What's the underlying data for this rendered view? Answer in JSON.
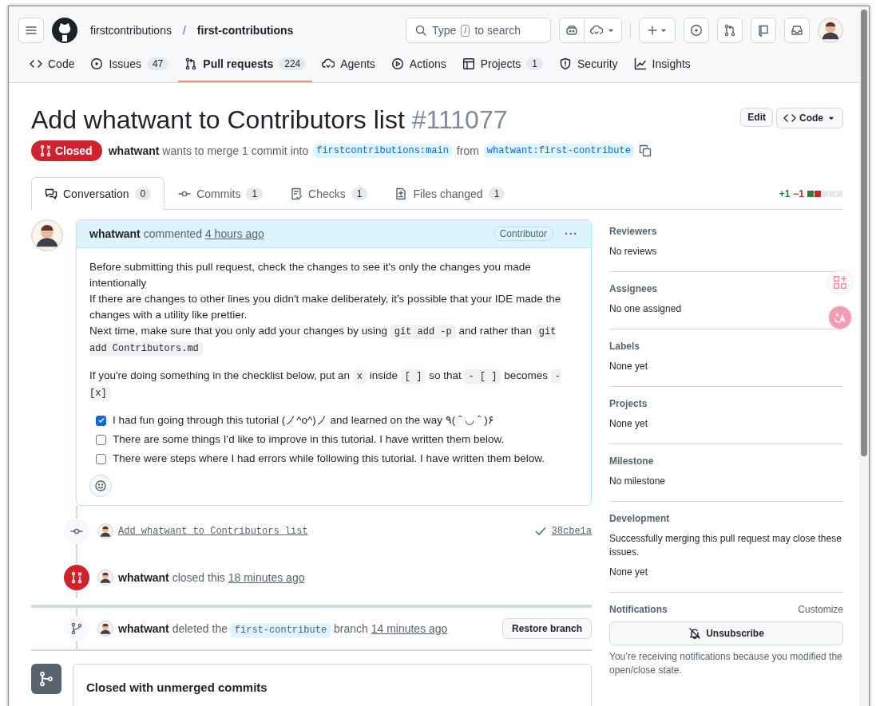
{
  "header": {
    "owner": "firstcontributions",
    "separator": "/",
    "repo": "first-contributions",
    "search": {
      "before": "Type",
      "key": "/",
      "after": "to search"
    }
  },
  "nav": [
    {
      "kind": "code",
      "label": "Code",
      "selected": false
    },
    {
      "kind": "issue",
      "label": "Issues",
      "count": "47",
      "selected": false
    },
    {
      "kind": "pr",
      "label": "Pull requests",
      "count": "224",
      "selected": true
    },
    {
      "kind": "agent",
      "label": "Agents",
      "selected": false
    },
    {
      "kind": "play",
      "label": "Actions",
      "selected": false
    },
    {
      "kind": "table",
      "label": "Projects",
      "count": "1",
      "selected": false
    },
    {
      "kind": "shield",
      "label": "Security",
      "selected": false
    },
    {
      "kind": "graph",
      "label": "Insights",
      "selected": false
    }
  ],
  "pr": {
    "title": "Add whatwant to Contributors list",
    "number": "#111077",
    "state": "Closed",
    "author": "whatwant",
    "summary": "wants to merge 1 commit into",
    "base": "firstcontributions:main",
    "from": "from",
    "head": "whatwant:first-contribute",
    "edit": "Edit",
    "code": "Code"
  },
  "tabs": [
    {
      "kind": "conversation",
      "label": "Conversation",
      "count": "0",
      "selected": true
    },
    {
      "kind": "commit",
      "label": "Commits",
      "count": "1",
      "selected": false
    },
    {
      "kind": "checks",
      "label": "Checks",
      "count": "1",
      "selected": false
    },
    {
      "kind": "files",
      "label": "Files changed",
      "count": "1",
      "selected": false
    }
  ],
  "diffstat": {
    "added": "+1",
    "removed": "−1",
    "blocks": [
      {
        "color": "#1f883d"
      },
      {
        "color": "#cf222e"
      },
      {
        "color": "#e6eaef"
      },
      {
        "color": "#e6eaef"
      },
      {
        "color": "#e6eaef"
      }
    ]
  },
  "comment": {
    "author": "whatwant",
    "action": "commented",
    "time": "4 hours ago",
    "role": "Contributor",
    "menu": "···",
    "paragraphs": [
      {
        "lines": [
          [
            {
              "text": "Before submitting this pull request, check the changes to see it's only the changes you made intentionally",
              "code": false
            }
          ],
          [
            {
              "text": "If there are changes to other lines you didn't make deliberately, it's possible that your IDE made the changes with a utility like prettier.",
              "code": false
            }
          ],
          [
            {
              "text": "Next time, make sure that you only add your changes by using ",
              "code": false
            },
            {
              "text": "git add -p",
              "code": true
            },
            {
              "text": " and rather than ",
              "code": false
            },
            {
              "text": "git add Contributors.md",
              "code": true
            }
          ]
        ]
      },
      {
        "lines": [
          [
            {
              "text": "If you're doing something in the checklist below, put an ",
              "code": false
            },
            {
              "text": "x",
              "code": true
            },
            {
              "text": " inside ",
              "code": false
            },
            {
              "text": "[ ]",
              "code": true
            },
            {
              "text": " so that ",
              "code": false
            },
            {
              "text": "- [ ]",
              "code": true
            },
            {
              "text": " becomes ",
              "code": false
            },
            {
              "text": "- [x]",
              "code": true
            }
          ]
        ]
      }
    ],
    "tasks": [
      {
        "text": "I had fun going through this tutorial (ノ^o^)ノ and learned on the way ٩( ˆ ◡ ˆ )۶",
        "checked": true
      },
      {
        "text": "There are some things I'd like to improve in this tutorial. I have written them below.",
        "checked": false
      },
      {
        "text": "There were steps where I had errors while following this tutorial. I have written them below.",
        "checked": false
      }
    ]
  },
  "timeline": [
    {
      "kind": "commit",
      "message": "Add whatwant to Contributors list",
      "passed": true,
      "sha": "38cbe1a"
    },
    {
      "kind": "closed",
      "author": "whatwant",
      "text": "closed this",
      "time": "18 minutes ago"
    },
    {
      "kind": "deleted",
      "author": "whatwant",
      "text": "deleted the",
      "branch": "first-contribute",
      "after": "branch",
      "time": "14 minutes ago",
      "button": "Restore branch"
    }
  ],
  "merge_box": {
    "title": "Closed with unmerged commits"
  },
  "sidebar": [
    {
      "title": "Reviewers",
      "lines": [
        "No reviews"
      ]
    },
    {
      "title": "Assignees",
      "lines": [
        "No one assigned"
      ]
    },
    {
      "title": "Labels",
      "lines": [
        "None yet"
      ]
    },
    {
      "title": "Projects",
      "lines": [
        "None yet"
      ]
    },
    {
      "title": "Milestone",
      "lines": [
        "No milestone"
      ]
    },
    {
      "title": "Development",
      "lines": [
        "Successfully merging this pull request may close these issues.",
        "None yet"
      ]
    }
  ],
  "notifications": {
    "title": "Notifications",
    "customize": "Customize",
    "button": "Unsubscribe",
    "note": "You’re receiving notifications because you modified the open/close state."
  }
}
